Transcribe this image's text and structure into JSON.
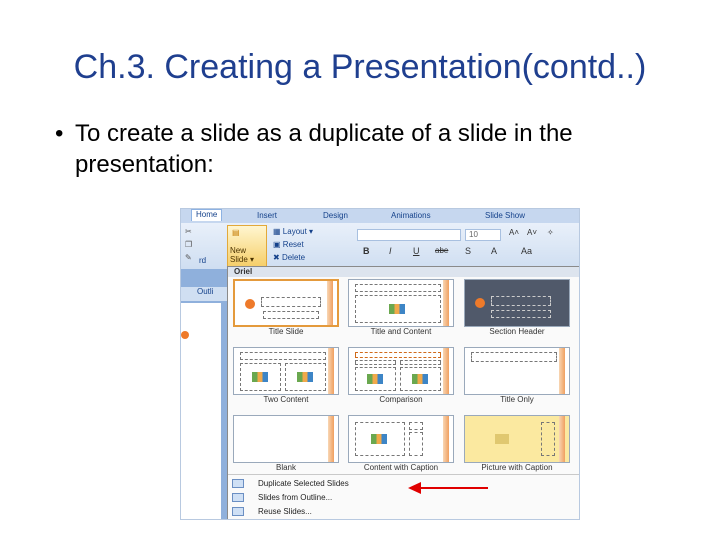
{
  "slide": {
    "title": "Ch.3. Creating a Presentation(contd..)",
    "bullet_symbol": "•",
    "bullet_text": "To create a slide as a duplicate of a slide in the presentation:"
  },
  "ribbon": {
    "tabs": [
      "Home",
      "Insert",
      "Design",
      "Animations",
      "Slide Show"
    ],
    "layout_label": "Layout",
    "reset_label": "Reset",
    "delete_label": "Delete",
    "new_slide_label_1": "New",
    "new_slide_label_2": "Slide",
    "font_size": "10",
    "format_buttons": [
      "B",
      "I",
      "U",
      "abe",
      "S",
      "A",
      "Aa"
    ],
    "clipboard_label": "rd",
    "outline_label": "Outli"
  },
  "menu": {
    "theme_header": "Oriel",
    "layouts": [
      "Title Slide",
      "Title and Content",
      "Section Header",
      "Two Content",
      "Comparison",
      "Title Only",
      "Blank",
      "Content with Caption",
      "Picture with Caption"
    ],
    "commands": [
      "Duplicate Selected Slides",
      "Slides from Outline...",
      "Reuse Slides..."
    ]
  },
  "colors": {
    "title": "#1f3f8f",
    "accent_orange": "#ee7a2a",
    "arrow": "#e00000",
    "ribbon_blue": "#15428b"
  }
}
